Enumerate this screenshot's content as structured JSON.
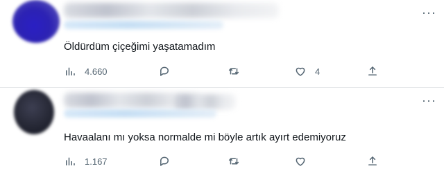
{
  "tweets": [
    {
      "text": "Öldürdüm çiçeğimi yaşatamadım",
      "views": "4.660",
      "likes": "4",
      "more_glyph": "···"
    },
    {
      "text": "Havaalanı mı yoksa normalde mi böyle artık ayırt edemiyoruz",
      "views": "1.167",
      "likes": "",
      "more_glyph": "···"
    }
  ],
  "icons": {
    "views": "bar-chart-icon",
    "reply": "speech-bubble-icon",
    "retweet": "retweet-icon",
    "like": "heart-icon",
    "share": "share-upload-icon",
    "more": "more-dots-icon"
  },
  "colors": {
    "text": "#0f1419",
    "muted": "#536471",
    "divider": "#e6e8ea"
  }
}
